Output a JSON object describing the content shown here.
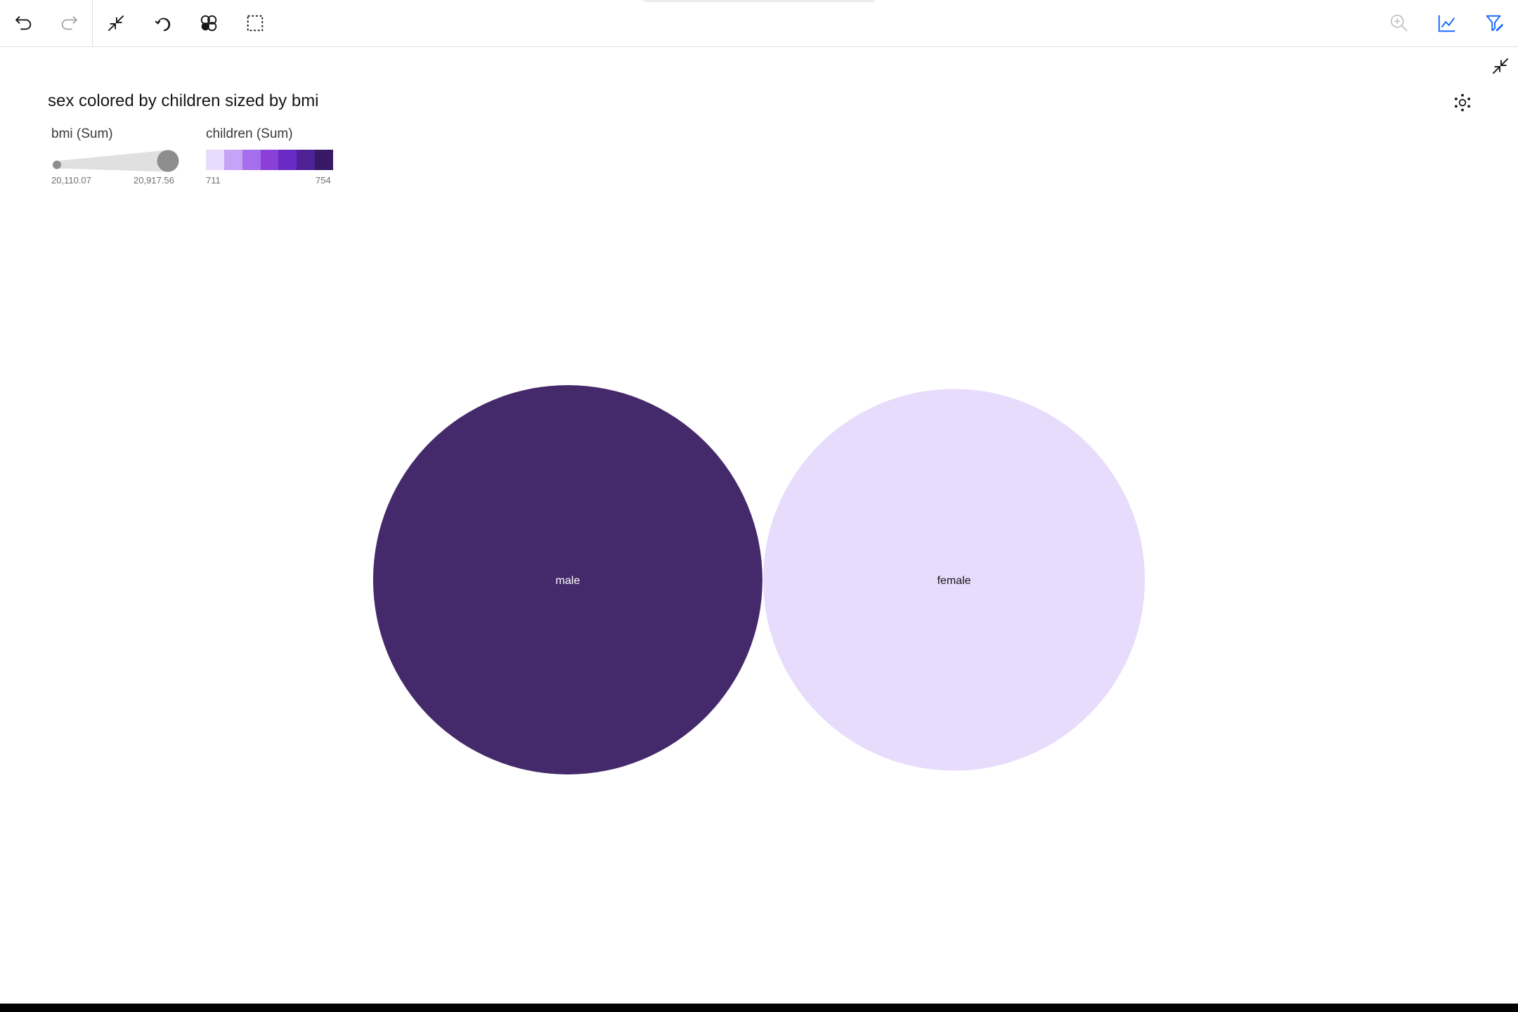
{
  "toolbar": {
    "left_tools": [
      {
        "name": "undo-icon",
        "label": "Undo"
      },
      {
        "name": "redo-icon",
        "label": "Redo"
      },
      {
        "name": "collapse-icon",
        "label": "Collapse"
      },
      {
        "name": "reset-icon",
        "label": "Reset"
      },
      {
        "name": "bubble-chart-icon",
        "label": "Bubble chart"
      },
      {
        "name": "select-area-icon",
        "label": "Select"
      }
    ],
    "right_tools": [
      {
        "name": "zoom-in-icon",
        "label": "Zoom in"
      },
      {
        "name": "line-chart-icon",
        "label": "Chart"
      },
      {
        "name": "filter-edit-icon",
        "label": "Filter"
      }
    ]
  },
  "colors": {
    "accent": "#0f62fe",
    "dark_purple": "#452a6b",
    "light_purple": "#e8dcfd"
  },
  "chart_data": {
    "type": "bubble",
    "title": "sex colored by children sized by bmi",
    "size_legend": {
      "label": "bmi (Sum)",
      "min": "20,110.07",
      "max": "20,917.56"
    },
    "color_legend": {
      "label": "children (Sum)",
      "min": "711",
      "max": "754",
      "steps": [
        "#e8dcfd",
        "#c5a3f6",
        "#a56eed",
        "#8a3fd9",
        "#6929c4",
        "#4f2196",
        "#381966"
      ]
    },
    "points": [
      {
        "category": "male",
        "bmi": 20917.56,
        "children": 754,
        "color": "#452a6b",
        "label_color": "#ffffff"
      },
      {
        "category": "female",
        "bmi": 20110.07,
        "children": 711,
        "color": "#e8dcfd",
        "label_color": "#161616"
      }
    ]
  }
}
